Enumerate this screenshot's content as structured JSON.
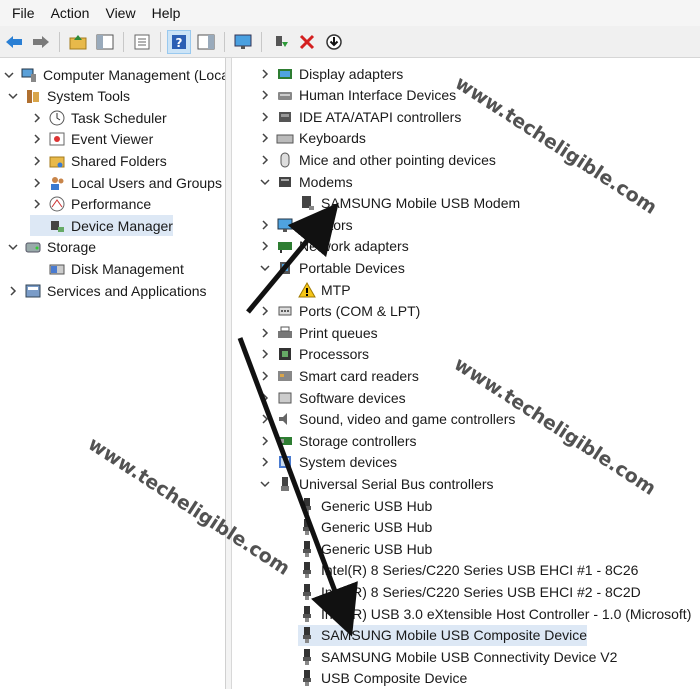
{
  "menu": [
    "File",
    "Action",
    "View",
    "Help"
  ],
  "toolbar": {
    "icons": [
      "back-arrow-icon",
      "forward-arrow-icon",
      "up-folder-icon",
      "show-hide-tree-icon",
      "properties-icon",
      "help-icon",
      "action-pane-icon",
      "monitor-icon",
      "update-driver-icon",
      "uninstall-x-icon",
      "scan-download-icon"
    ]
  },
  "left_tree": [
    {
      "label": "Computer Management (Local",
      "chev": "down",
      "icon": "computer-management-icon"
    },
    {
      "label": "System Tools",
      "chev": "down",
      "icon": "system-tools-icon"
    },
    {
      "label": "Task Scheduler",
      "chev": "right",
      "icon": "clock-icon"
    },
    {
      "label": "Event Viewer",
      "chev": "right",
      "icon": "event-viewer-icon"
    },
    {
      "label": "Shared Folders",
      "chev": "right",
      "icon": "shared-folder-icon"
    },
    {
      "label": "Local Users and Groups",
      "chev": "right",
      "icon": "users-icon"
    },
    {
      "label": "Performance",
      "chev": "right",
      "icon": "performance-icon"
    },
    {
      "label": "Device Manager",
      "chev": "",
      "icon": "device-manager-icon",
      "selected": true
    },
    {
      "label": "Storage",
      "chev": "down",
      "icon": "storage-icon"
    },
    {
      "label": "Disk Management",
      "chev": "",
      "icon": "disk-management-icon"
    },
    {
      "label": "Services and Applications",
      "chev": "right",
      "icon": "services-icon"
    }
  ],
  "right_tree": [
    {
      "label": "Display adapters",
      "chev": "right",
      "icon": "display-adapter-icon"
    },
    {
      "label": "Human Interface Devices",
      "chev": "right",
      "icon": "hid-icon"
    },
    {
      "label": "IDE ATA/ATAPI controllers",
      "chev": "right",
      "icon": "ide-controller-icon"
    },
    {
      "label": "Keyboards",
      "chev": "right",
      "icon": "keyboard-icon"
    },
    {
      "label": "Mice and other pointing devices",
      "chev": "right",
      "icon": "mouse-icon"
    },
    {
      "label": "Modems",
      "chev": "down",
      "icon": "modem-icon"
    },
    {
      "label": "SAMSUNG Mobile USB Modem",
      "chev": "",
      "icon": "modem-device-icon",
      "child": true
    },
    {
      "label": "Monitors",
      "chev": "right",
      "icon": "monitor-icon"
    },
    {
      "label": "Network adapters",
      "chev": "right",
      "icon": "network-adapter-icon"
    },
    {
      "label": "Portable Devices",
      "chev": "down",
      "icon": "portable-device-icon"
    },
    {
      "label": "MTP",
      "chev": "",
      "icon": "warning-icon",
      "child": true
    },
    {
      "label": "Ports (COM & LPT)",
      "chev": "right",
      "icon": "port-icon"
    },
    {
      "label": "Print queues",
      "chev": "right",
      "icon": "printer-icon"
    },
    {
      "label": "Processors",
      "chev": "right",
      "icon": "processor-icon"
    },
    {
      "label": "Smart card readers",
      "chev": "right",
      "icon": "smart-card-icon"
    },
    {
      "label": "Software devices",
      "chev": "right",
      "icon": "software-device-icon"
    },
    {
      "label": "Sound, video and game controllers",
      "chev": "right",
      "icon": "speaker-icon"
    },
    {
      "label": "Storage controllers",
      "chev": "right",
      "icon": "storage-controller-icon"
    },
    {
      "label": "System devices",
      "chev": "right",
      "icon": "system-device-icon"
    },
    {
      "label": "Universal Serial Bus controllers",
      "chev": "down",
      "icon": "usb-controller-icon"
    },
    {
      "label": "Generic USB Hub",
      "chev": "",
      "icon": "usb-plug-icon",
      "child": true
    },
    {
      "label": "Generic USB Hub",
      "chev": "",
      "icon": "usb-plug-icon",
      "child": true
    },
    {
      "label": "Generic USB Hub",
      "chev": "",
      "icon": "usb-plug-icon",
      "child": true
    },
    {
      "label": "Intel(R) 8 Series/C220 Series USB EHCI #1 - 8C26",
      "chev": "",
      "icon": "usb-plug-icon",
      "child": true
    },
    {
      "label": "Intel(R) 8 Series/C220 Series USB EHCI #2 - 8C2D",
      "chev": "",
      "icon": "usb-plug-icon",
      "child": true
    },
    {
      "label": "Intel(R) USB 3.0 eXtensible Host Controller - 1.0 (Microsoft)",
      "chev": "",
      "icon": "usb-plug-icon",
      "child": true
    },
    {
      "label": "SAMSUNG Mobile USB Composite Device",
      "chev": "",
      "icon": "usb-plug-icon",
      "child": true,
      "selected": true
    },
    {
      "label": "SAMSUNG Mobile USB Connectivity Device V2",
      "chev": "",
      "icon": "usb-plug-icon",
      "child": true
    },
    {
      "label": "USB Composite Device",
      "chev": "",
      "icon": "usb-plug-icon",
      "child": true
    }
  ],
  "watermark": "www.techeligible.com",
  "colors": {
    "selection": "#dde8f5",
    "accent": "#0078d7",
    "annotation_arrow": "#111111"
  }
}
